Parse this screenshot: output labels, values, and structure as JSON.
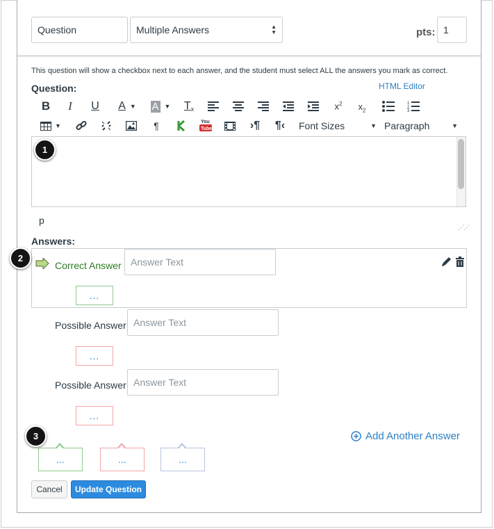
{
  "header": {
    "question_name": "Question",
    "question_type": "Multiple Answers",
    "pts_label": "pts:",
    "pts_value": "1"
  },
  "description": "This question will show a checkbox next to each answer, and the student must select ALL the answers you mark as correct.",
  "question_label": "Question:",
  "html_editor_link": "HTML Editor",
  "toolbar": {
    "bold": "B",
    "italic": "I",
    "underline": "U",
    "text_color": "A",
    "bg_color": "A",
    "clear": "T",
    "font_sizes": "Font Sizes",
    "paragraph": "Paragraph"
  },
  "editor_path": "p",
  "answers_label": "Answers:",
  "answers": [
    {
      "label": "Correct Answer",
      "placeholder": "Answer Text",
      "dots": "..."
    },
    {
      "label": "Possible Answer",
      "placeholder": "Answer Text",
      "dots": "..."
    },
    {
      "label": "Possible Answer",
      "placeholder": "Answer Text",
      "dots": "..."
    }
  ],
  "comment_bubbles": [
    "...",
    "...",
    "..."
  ],
  "add_answer": "Add Another Answer",
  "buttons": {
    "cancel": "Cancel",
    "update": "Update Question"
  },
  "markers": [
    "1",
    "2",
    "3"
  ],
  "colors": {
    "accent": "#2d7ec6",
    "correct_green": "#2e7d23",
    "green_border": "#8fc98a",
    "red_border": "#f2a5a5",
    "blue_border": "#b7c4de",
    "primary_button": "#2d8bdf"
  }
}
